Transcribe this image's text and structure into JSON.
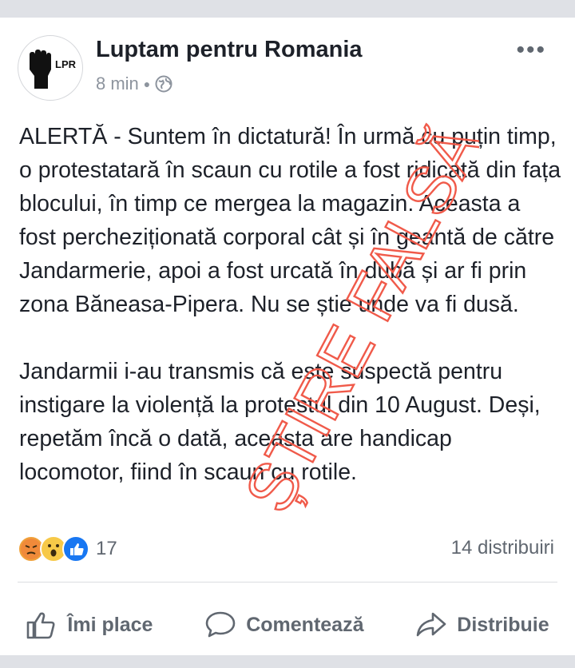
{
  "post": {
    "page_name": "Luptam pentru Romania",
    "avatar_text": "LPR",
    "time": "8 min",
    "privacy_icon": "globe-icon",
    "more_icon": "more-icon",
    "paragraphs": [
      "ALERTĂ - Suntem în dictatură! În urmă cu puțin timp, o protestatară în scaun cu rotile a fost ridicată din fața blocului, în timp ce mergea la magazin. Aceasta a fost percheziționată corporal cât și în geantă de către Jandarmerie, apoi a fost urcată în dubă și ar fi prin zona Băneasa-Pipera. Nu se știe unde va fi dusă.",
      "Jandarmii i-au transmis că este suspectă pentru instigare la violență la protestul din 10 August. Deși, repetăm încă o dată, aceasta are handicap locomotor, fiind în scaun cu rotile."
    ],
    "stamp_text": "ȘTIRE FALSĂ",
    "stamp_color": "#f05a4a"
  },
  "stats": {
    "reactions": [
      "angry",
      "wow",
      "like"
    ],
    "reaction_count": "17",
    "shares": "14 distribuiri"
  },
  "actions": {
    "like": "Îmi place",
    "comment": "Comentează",
    "share": "Distribuie"
  },
  "colors": {
    "text": "#1d2129",
    "secondary": "#606770",
    "like_blue": "#1877f2"
  }
}
